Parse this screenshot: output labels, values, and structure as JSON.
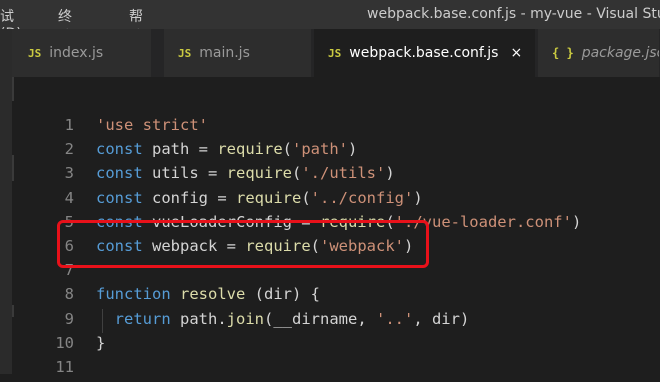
{
  "menu": {
    "items": [
      "试(D)",
      "终端(T)",
      "帮助(H)"
    ]
  },
  "window_title": "webpack.base.conf.js - my-vue - Visual Studio",
  "tabs": [
    {
      "icon": "JS",
      "label": "index.js",
      "active": false,
      "italic": false
    },
    {
      "icon": "JS",
      "label": "main.js",
      "active": false,
      "italic": false
    },
    {
      "icon": "JS",
      "label": "webpack.base.conf.js",
      "active": true,
      "italic": false,
      "close": "×"
    },
    {
      "icon": "{ }",
      "label": "package.json",
      "active": false,
      "italic": true
    }
  ],
  "code_lines": [
    {
      "n": "1",
      "tokens": [
        {
          "t": "str",
          "v": "'use strict'"
        }
      ]
    },
    {
      "n": "2",
      "tokens": [
        {
          "t": "kw",
          "v": "const"
        },
        {
          "t": "plain",
          "v": " path = "
        },
        {
          "t": "fn",
          "v": "require"
        },
        {
          "t": "plain",
          "v": "("
        },
        {
          "t": "str",
          "v": "'path'"
        },
        {
          "t": "plain",
          "v": ")"
        }
      ]
    },
    {
      "n": "3",
      "tokens": [
        {
          "t": "kw",
          "v": "const"
        },
        {
          "t": "plain",
          "v": " utils = "
        },
        {
          "t": "fn",
          "v": "require"
        },
        {
          "t": "plain",
          "v": "("
        },
        {
          "t": "str",
          "v": "'./utils'"
        },
        {
          "t": "plain",
          "v": ")"
        }
      ]
    },
    {
      "n": "4",
      "tokens": [
        {
          "t": "kw",
          "v": "const"
        },
        {
          "t": "plain",
          "v": " config = "
        },
        {
          "t": "fn",
          "v": "require"
        },
        {
          "t": "plain",
          "v": "("
        },
        {
          "t": "str",
          "v": "'../config'"
        },
        {
          "t": "plain",
          "v": ")"
        }
      ]
    },
    {
      "n": "5",
      "tokens": [
        {
          "t": "kw",
          "v": "const"
        },
        {
          "t": "plain",
          "v": " vueLoaderConfig = "
        },
        {
          "t": "fn",
          "v": "require"
        },
        {
          "t": "plain",
          "v": "("
        },
        {
          "t": "str",
          "v": "'./vue-loader.conf'"
        },
        {
          "t": "plain",
          "v": ")"
        }
      ]
    },
    {
      "n": "6",
      "tokens": [
        {
          "t": "kw",
          "v": "const"
        },
        {
          "t": "plain",
          "v": " webpack = "
        },
        {
          "t": "fn",
          "v": "require"
        },
        {
          "t": "plain",
          "v": "("
        },
        {
          "t": "str",
          "v": "'webpack'"
        },
        {
          "t": "plain",
          "v": ")"
        }
      ]
    },
    {
      "n": "7",
      "tokens": []
    },
    {
      "n": "8",
      "tokens": [
        {
          "t": "kw",
          "v": "function"
        },
        {
          "t": "plain",
          "v": " "
        },
        {
          "t": "fn",
          "v": "resolve"
        },
        {
          "t": "plain",
          "v": " (dir) {"
        }
      ]
    },
    {
      "n": "9",
      "tokens": [
        {
          "t": "plain",
          "v": "  "
        },
        {
          "t": "kw",
          "v": "return"
        },
        {
          "t": "plain",
          "v": " path."
        },
        {
          "t": "fn",
          "v": "join"
        },
        {
          "t": "plain",
          "v": "(__dirname, "
        },
        {
          "t": "str",
          "v": "'..'"
        },
        {
          "t": "plain",
          "v": ", dir)"
        }
      ]
    },
    {
      "n": "10",
      "tokens": [
        {
          "t": "plain",
          "v": "}"
        }
      ]
    },
    {
      "n": "11",
      "tokens": []
    }
  ],
  "colors": {
    "background": "#1e1e1e",
    "keyword": "#569cd6",
    "string": "#ce9178",
    "function": "#dcdcaa",
    "highlight_box": "#e8111a"
  }
}
